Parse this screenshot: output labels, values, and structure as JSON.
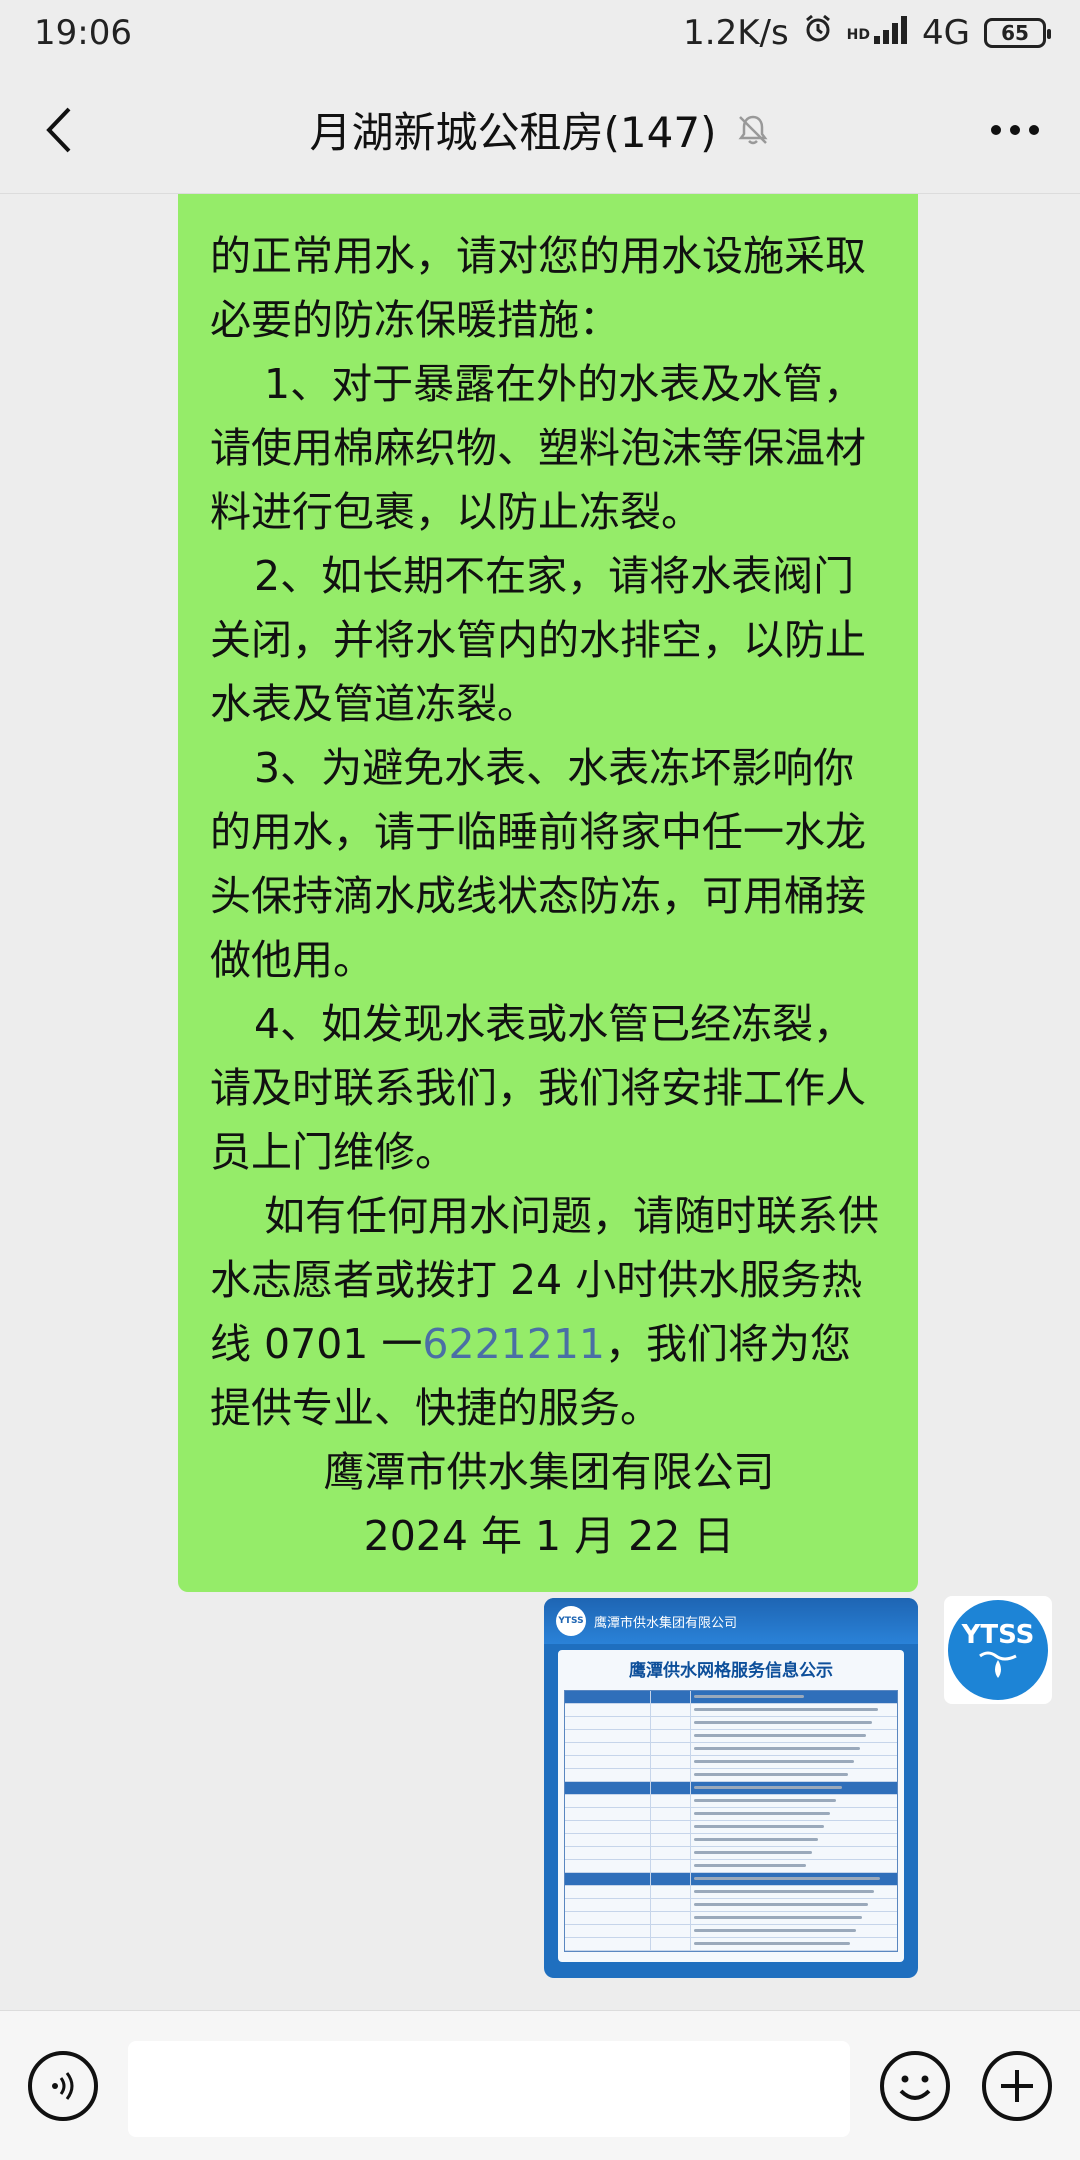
{
  "status_bar": {
    "time": "19:06",
    "speed": "1.2K/s",
    "network": "4G",
    "battery": "65",
    "hd": "HD"
  },
  "header": {
    "title": "月湖新城公租房(147)"
  },
  "message": {
    "lines": [
      "的正常用水，请对您的用水设施采取必要的防冻保暖措施：",
      "1、对于暴露在外的水表及水管，请使用棉麻织物、塑料泡沫等保温材料进行包裹，以防止冻裂。",
      "2、如长期不在家，请将水表阀门关闭，并将水管内的水排空，以防止水表及管道冻裂。",
      "3、为避免水表、水表冻坏影响你的用水，请于临睡前将家中任一水龙头保持滴水成线状态防冻，可用桶接做他用。",
      "4、如发现水表或水管已经冻裂，请及时联系我们，我们将安排工作人员上门维修。",
      "如有任何用水问题，请随时联系供水志愿者或拨打 24 小时供水服务热线 0701 一",
      "6221211",
      "，我们将为您提供专业、快捷的服务。",
      "鹰潭市供水集团有限公司",
      "2024 年 1 月 22 日"
    ]
  },
  "image_message": {
    "company": "鹰潭市供水集团有限公司",
    "title": "鹰潭供水网格服务信息公示",
    "logo": "YTSS"
  },
  "avatar": {
    "label": "YTSS"
  },
  "icons": {
    "back": "chevron-left-icon",
    "mute": "bell-off-icon",
    "more": "more-icon",
    "voice": "voice-icon",
    "emoji": "emoji-icon",
    "plus": "plus-icon"
  }
}
